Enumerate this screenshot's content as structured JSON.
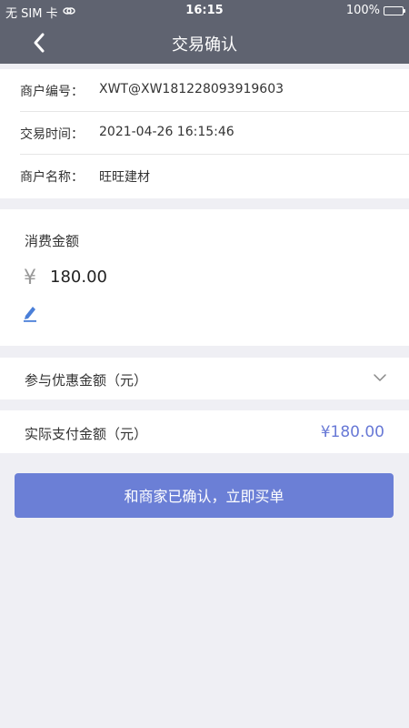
{
  "status_bar": {
    "carrier": "无 SIM 卡",
    "time": "16:15",
    "battery_percent": "100%",
    "battery_level": 1.0
  },
  "nav": {
    "title": "交易确认"
  },
  "merchant_info": [
    {
      "label": "商户编号：",
      "value": "XWT@XW181228093919603"
    },
    {
      "label": "交易时间：",
      "value": "2021-04-26 16:15:46"
    },
    {
      "label": "商户名称：",
      "value": "旺旺建材"
    }
  ],
  "amount": {
    "title": "消费金额",
    "currency_symbol": "¥",
    "value": "180.00"
  },
  "discount": {
    "label": "参与优惠金额（元）"
  },
  "payment": {
    "label": "实际支付金额（元）",
    "value": "¥180.00"
  },
  "confirm_button": {
    "label": "和商家已确认，立即买单"
  },
  "colors": {
    "nav_bg": "#5f6370",
    "accent": "#6b7fd6",
    "page_bg": "#efeff4"
  },
  "icons": {
    "back": "chevron-left-icon",
    "wifi": "link-icon",
    "edit": "pencil-icon",
    "expand": "chevron-down-icon"
  }
}
